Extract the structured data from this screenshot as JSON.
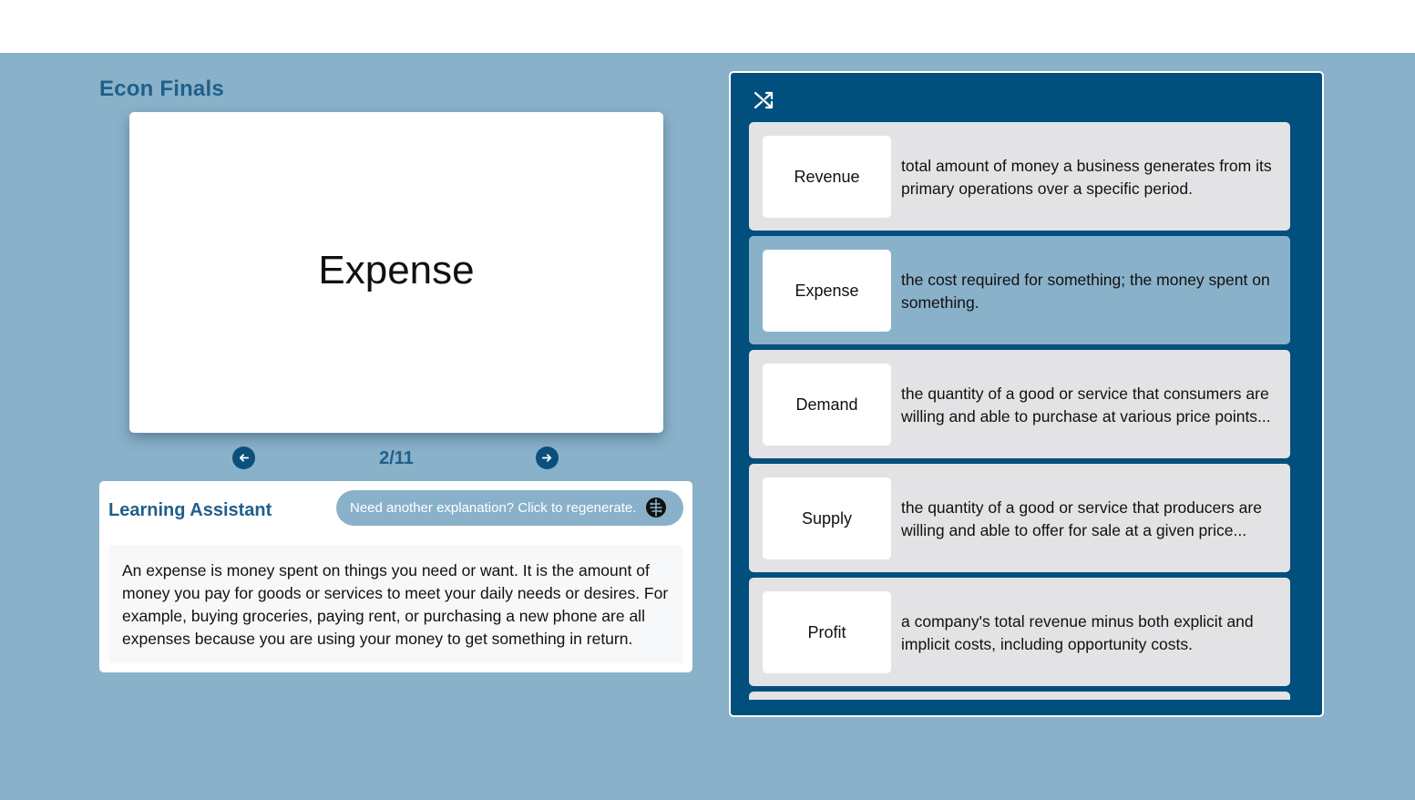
{
  "deck": {
    "title": "Econ Finals"
  },
  "flashcard": {
    "term": "Expense"
  },
  "navigation": {
    "counter": "2/11",
    "current": 2,
    "total": 11
  },
  "assistant": {
    "title": "Learning Assistant",
    "regenerate_label": "Need another explanation? Click to regenerate.",
    "explanation": "An expense is money spent on things you need or want. It is the amount of money you pay for goods or services to meet your daily needs or desires. For example, buying groceries, paying rent, or purchasing a new phone are all expenses because you are using your money to get something in return."
  },
  "card_list": {
    "items": [
      {
        "term": "Revenue",
        "definition": "total amount of money a business generates from its primary operations over a specific period."
      },
      {
        "term": "Expense",
        "definition": "the cost required for something; the money spent on something."
      },
      {
        "term": "Demand",
        "definition": "the quantity of a good or service that consumers are willing and able to purchase at various price points..."
      },
      {
        "term": "Supply",
        "definition": "the quantity of a good or service that producers are willing and able to offer for sale at a given price..."
      },
      {
        "term": "Profit",
        "definition": "a company's total revenue minus both explicit and implicit costs, including opportunity costs."
      },
      {
        "term": "",
        "definition": ""
      }
    ],
    "active_index": 1
  },
  "icons": {
    "prev": "arrow-left-icon",
    "next": "arrow-right-icon",
    "shuffle": "shuffle-icon",
    "regenerate": "brain-icon"
  },
  "colors": {
    "background": "#8ab1ca",
    "accent": "#1f5f8b",
    "panel": "#014f7d",
    "card": "#e3e3e6"
  }
}
